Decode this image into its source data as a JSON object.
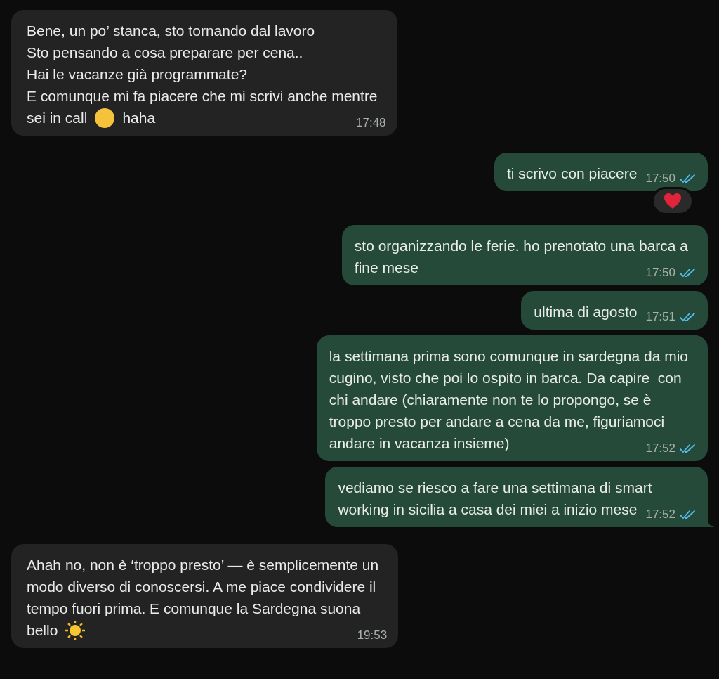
{
  "messages": [
    {
      "sent": false,
      "lines": [
        [
          {
            "kind": "text",
            "text": "Bene, un po’ stanca, sto tornando dal lavoro"
          }
        ],
        [
          {
            "kind": "text",
            "text": "Sto pensando a cosa preparare per cena.."
          }
        ],
        [
          {
            "kind": "text",
            "text": "Hai le vacanze già programmate?"
          }
        ],
        [
          {
            "kind": "text",
            "text": "E comunque mi fa piacere che mi scrivi anche mentre"
          }
        ],
        [
          {
            "kind": "text",
            "text": "sei in call"
          },
          {
            "kind": "relieved_emoji"
          },
          {
            "kind": "text",
            "text": "haha"
          }
        ]
      ],
      "time": "17:48"
    },
    {
      "sent": true,
      "lines": [
        [
          {
            "kind": "text",
            "text": "ti scrivo con piacere"
          }
        ]
      ],
      "time": "17:50",
      "read": true,
      "reacted": true
    },
    {
      "sent": true,
      "lines": [
        [
          {
            "kind": "text",
            "text": "sto organizzando le ferie. ho prenotato una barca a"
          }
        ],
        [
          {
            "kind": "text",
            "text": "fine mese"
          }
        ]
      ],
      "time": "17:50",
      "read": true
    },
    {
      "sent": true,
      "lines": [
        [
          {
            "kind": "text",
            "text": "ultima di agosto"
          }
        ]
      ],
      "time": "17:51",
      "read": true
    },
    {
      "sent": true,
      "lines": [
        [
          {
            "kind": "text",
            "text": "la settimana prima sono comunque in sardegna da mio"
          }
        ],
        [
          {
            "kind": "text",
            "text": "cugino, visto che poi lo ospito in barca. Da capire  con"
          }
        ],
        [
          {
            "kind": "text",
            "text": "chi andare (chiaramente non te lo propongo, se è"
          }
        ],
        [
          {
            "kind": "text",
            "text": "troppo presto per andare a cena da me, figuriamoci"
          }
        ],
        [
          {
            "kind": "text",
            "text": "andare in vacanza insieme)"
          }
        ]
      ],
      "time": "17:52",
      "read": true
    },
    {
      "sent": true,
      "lines": [
        [
          {
            "kind": "text",
            "text": "vediamo se riesco a fare una settimana di smart"
          }
        ],
        [
          {
            "kind": "text",
            "text": "working in sicilia a casa dei miei a inizio mese"
          }
        ]
      ],
      "time": "17:52",
      "read": true,
      "tail": true
    },
    {
      "sent": false,
      "lines": [
        [
          {
            "kind": "text",
            "text": "Ahah no, non è ‘troppo presto’ — è semplicemente un"
          }
        ],
        [
          {
            "kind": "text",
            "text": "modo diverso di conoscersi. A me piace condividere il"
          }
        ],
        [
          {
            "kind": "text",
            "text": "tempo fuori prima. E comunque la Sardegna suona"
          }
        ],
        [
          {
            "kind": "text",
            "text": "bello"
          },
          {
            "kind": "sun_emoji"
          }
        ]
      ],
      "time": "19:53"
    }
  ]
}
